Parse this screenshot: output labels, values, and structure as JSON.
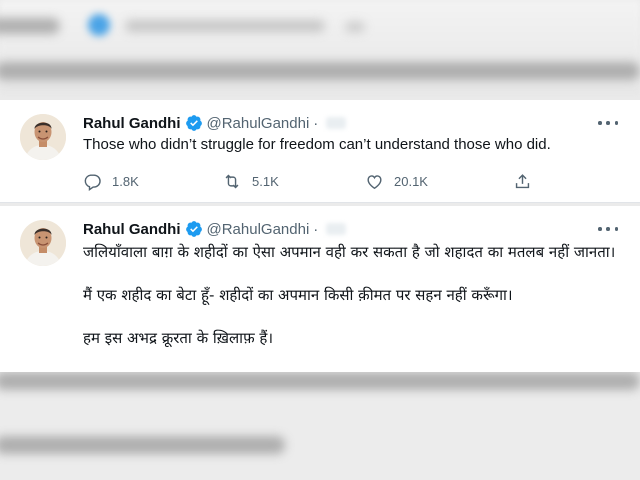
{
  "tweet1": {
    "author_name": "Rahul Gandhi",
    "author_handle": "@RahulGandhi",
    "separator": "·",
    "text": "Those who didn’t struggle for freedom can’t understand those who did.",
    "replies": "1.8K",
    "retweets": "5.1K",
    "likes": "20.1K"
  },
  "tweet2": {
    "author_name": "Rahul Gandhi",
    "author_handle": "@RahulGandhi",
    "separator": "·",
    "paragraphs": [
      "जलियाँवाला बाग़ के शहीदों का ऐसा अपमान वही कर सकता है जो शहादत का मतलब नहीं जानता।",
      "मैं एक शहीद का बेटा हूँ- शहीदों का अपमान किसी क़ीमत पर सहन नहीं करूँगा।",
      "हम इस अभद्र क्रूरता के ख़िलाफ़ हैं।"
    ]
  },
  "colors": {
    "verified_blue": "#1d9bf0",
    "text_primary": "#0f1419",
    "text_secondary": "#536471"
  },
  "icons": [
    "verified-badge-icon",
    "more-icon",
    "reply-icon",
    "retweet-icon",
    "like-icon",
    "share-icon"
  ]
}
